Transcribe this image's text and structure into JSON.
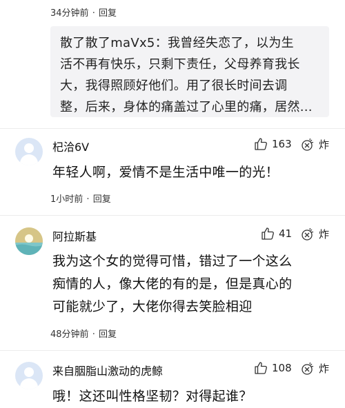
{
  "top_meta": {
    "time": "34分钟前",
    "sep": "·",
    "reply": "回复"
  },
  "quote": {
    "lines": [
      "散了散了maVx5：我曾经失恋了，以为生",
      "活不再有快乐，只剩下责任，父母养育我长",
      "大，我得照顾好他们。用了很长时间去调",
      "整，后来，身体的痛盖过了心里的痛，居然..."
    ]
  },
  "comments": [
    {
      "username": "杞洽6V",
      "likes": "163",
      "boom_label": "炸",
      "lines": [
        "年轻人啊，爱情不是生活中唯一的光！"
      ],
      "time": "1小时前",
      "sep": "·",
      "reply": "回复"
    },
    {
      "username": "阿拉斯基",
      "likes": "41",
      "boom_label": "炸",
      "lines": [
        "我为这个女的觉得可惜，错过了一个这么",
        "痴情的人，像大佬的有的是，但是真心的",
        "可能就少了，大佬你得去笑脸相迎"
      ],
      "time": "48分钟前",
      "sep": "·",
      "reply": "回复"
    },
    {
      "username": "来自胭脂山激动的虎鲸",
      "likes": "108",
      "boom_label": "炸",
      "lines": [
        "哦！这还叫性格坚韧？对得起谁？"
      ]
    }
  ]
}
